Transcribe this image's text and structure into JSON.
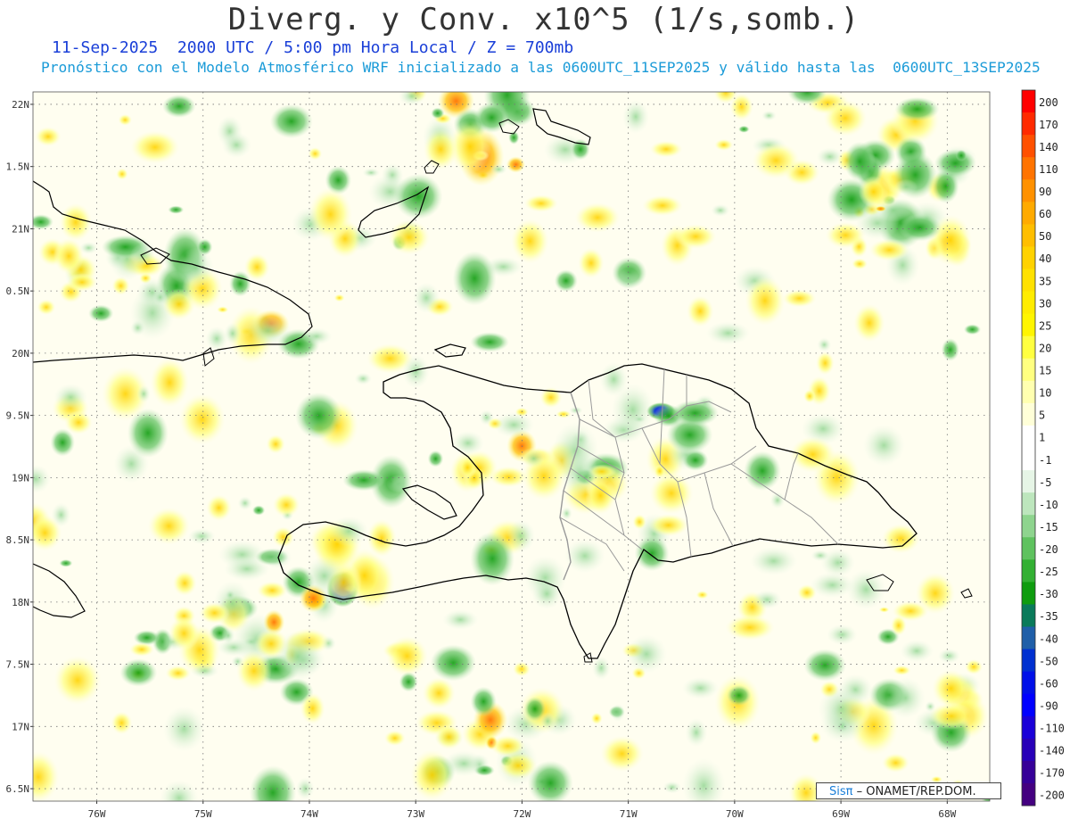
{
  "header": {
    "title": "Diverg. y Conv. x10^5 (1/s,somb.)",
    "subtitle_time": "11-Sep-2025  2000 UTC / 5:00 pm Hora Local / Z = 700mb",
    "subtitle_model": "Pronóstico con el Modelo Atmosférico WRF inicializado a las 0600UTC_11SEP2025 y válido hasta las  0600UTC_13SEP2025"
  },
  "map": {
    "lon_range": [
      -76.6,
      -67.6
    ],
    "lat_range": [
      16.4,
      22.1
    ],
    "lat_ticks": [
      {
        "value": 22.0,
        "label": "22N"
      },
      {
        "value": 21.5,
        "label": "1.5N"
      },
      {
        "value": 21.0,
        "label": "21N"
      },
      {
        "value": 20.5,
        "label": "0.5N"
      },
      {
        "value": 20.0,
        "label": "20N"
      },
      {
        "value": 19.5,
        "label": "9.5N"
      },
      {
        "value": 19.0,
        "label": "19N"
      },
      {
        "value": 18.5,
        "label": "8.5N"
      },
      {
        "value": 18.0,
        "label": "18N"
      },
      {
        "value": 17.5,
        "label": "7.5N"
      },
      {
        "value": 17.0,
        "label": "17N"
      },
      {
        "value": 16.5,
        "label": "6.5N"
      }
    ],
    "lon_ticks": [
      {
        "value": -76,
        "label": "76W"
      },
      {
        "value": -75,
        "label": "75W"
      },
      {
        "value": -74,
        "label": "74W"
      },
      {
        "value": -73,
        "label": "73W"
      },
      {
        "value": -72,
        "label": "72W"
      },
      {
        "value": -71,
        "label": "71W"
      },
      {
        "value": -70,
        "label": "70W"
      },
      {
        "value": -69,
        "label": "69W"
      },
      {
        "value": -68,
        "label": "68W"
      }
    ],
    "colors": {
      "coast": "#000000",
      "province_border": "#999999",
      "grid": "#777777",
      "background_field": "#fffde0"
    }
  },
  "colorbar": {
    "levels": [
      {
        "label": "200",
        "color": "#ff0000"
      },
      {
        "label": "170",
        "color": "#ff2a00"
      },
      {
        "label": "140",
        "color": "#ff5000"
      },
      {
        "label": "110",
        "color": "#ff7300"
      },
      {
        "label": "90",
        "color": "#ff9100"
      },
      {
        "label": "60",
        "color": "#ffaa00"
      },
      {
        "label": "50",
        "color": "#ffbe00"
      },
      {
        "label": "40",
        "color": "#ffd200"
      },
      {
        "label": "35",
        "color": "#ffe100"
      },
      {
        "label": "30",
        "color": "#ffec00"
      },
      {
        "label": "25",
        "color": "#fff500"
      },
      {
        "label": "20",
        "color": "#ffff40"
      },
      {
        "label": "15",
        "color": "#ffff80"
      },
      {
        "label": "10",
        "color": "#ffffb0"
      },
      {
        "label": "5",
        "color": "#ffffd8"
      },
      {
        "label": "1",
        "color": "#ffffff"
      },
      {
        "label": "-1",
        "color": "#ffffff"
      },
      {
        "label": "-5",
        "color": "#e6f5e6"
      },
      {
        "label": "-10",
        "color": "#bde6bd"
      },
      {
        "label": "-15",
        "color": "#8ed48e"
      },
      {
        "label": "-20",
        "color": "#5fc25f"
      },
      {
        "label": "-25",
        "color": "#33b033"
      },
      {
        "label": "-30",
        "color": "#0f9c0f"
      },
      {
        "label": "-35",
        "color": "#0a7a5a"
      },
      {
        "label": "-40",
        "color": "#1f5fa8"
      },
      {
        "label": "-50",
        "color": "#0030d0"
      },
      {
        "label": "-60",
        "color": "#0010e8"
      },
      {
        "label": "-90",
        "color": "#0000ff"
      },
      {
        "label": "-110",
        "color": "#1a00d8"
      },
      {
        "label": "-140",
        "color": "#2800b8"
      },
      {
        "label": "-170",
        "color": "#360098"
      },
      {
        "label": "-200",
        "color": "#440080"
      }
    ]
  },
  "credit": {
    "logo": "Sisπ",
    "text": " – ONAMET/REP.DOM."
  }
}
